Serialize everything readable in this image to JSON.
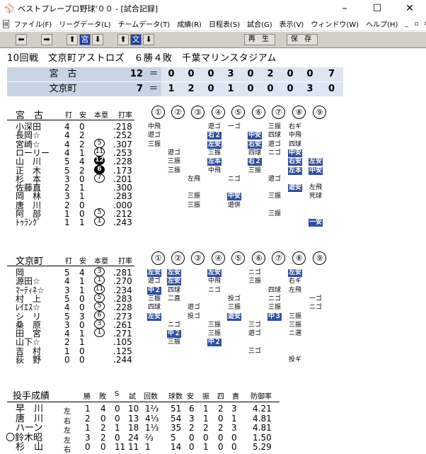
{
  "window": {
    "title": "ベストプレープロ野球'００ - [試合記録]",
    "min": "–",
    "max": "☐",
    "close": "✕"
  },
  "menu": [
    "ファイル(F)",
    "リーグデータ(L)",
    "チームデータ(T)",
    "成績(R)",
    "日程表(S)",
    "試合(G)",
    "表示(V)",
    "ウィンドウ(W)",
    "ヘルプ(H)"
  ],
  "mdi": [
    "_",
    "▫",
    "×"
  ],
  "toolbar": {
    "left": "⬅",
    "right": "➡",
    "team1": "宮",
    "down": "⬇",
    "up": "⬆",
    "team2": "文",
    "replay": "再 生",
    "save": "保 存"
  },
  "game": {
    "info": "10回戦　文京町アストロズ　６勝４敗　千葉マリンスタジアム"
  },
  "score": {
    "away": {
      "name": "宮　古",
      "total": "12",
      "eq": "＝",
      "innings": [
        "0",
        "0",
        "0",
        "3",
        "0",
        "2",
        "0",
        "0",
        "7"
      ]
    },
    "home": {
      "name": "文京町",
      "total": "7",
      "eq": "＝",
      "innings": [
        "1",
        "2",
        "0",
        "1",
        "0",
        "0",
        "0",
        "3",
        "0"
      ]
    }
  },
  "away_batting": {
    "team": "宮　古",
    "headers": [
      "打",
      "安",
      "本塁",
      "打率"
    ],
    "innings": [
      "①",
      "②",
      "③",
      "④",
      "⑤",
      "⑥",
      "⑦",
      "⑧",
      "⑨"
    ],
    "players": [
      {
        "name": "小深田",
        "ab": "4",
        "h": "0",
        "hr": "",
        "avg": ".218"
      },
      {
        "name": "長岡☆",
        "ab": "4",
        "h": "2",
        "hr": "",
        "avg": ".252"
      },
      {
        "name": "宮崎☆",
        "ab": "4",
        "h": "2",
        "hr": "5",
        "avg": ".307"
      },
      {
        "name": "ローリー",
        "ab": "4",
        "h": "1",
        "hr": "11",
        "avg": ".253"
      },
      {
        "name": "山　川",
        "ab": "5",
        "h": "4",
        "hr": "12",
        "avg": ".228"
      },
      {
        "name": "正　木",
        "ab": "5",
        "h": "2",
        "hr": "6",
        "avg": ".173"
      },
      {
        "name": "杉　本",
        "ab": "3",
        "h": "0",
        "hr": "7",
        "avg": ".201"
      },
      {
        "name": "佐藤直",
        "ab": "2",
        "h": "1",
        "hr": "",
        "avg": ".300"
      },
      {
        "name": "岡　林",
        "ab": "3",
        "h": "1",
        "hr": "",
        "avg": ".283"
      },
      {
        "name": "唐　川",
        "ab": "2",
        "h": "0",
        "hr": "",
        "avg": ".000"
      },
      {
        "name": "阿　部",
        "ab": "1",
        "h": "0",
        "hr": "5",
        "avg": ".212"
      },
      {
        "name": "ﾄｩﾗﾝｸﾞ",
        "ab": "1",
        "h": "1",
        "hr": "1",
        "avg": ".243"
      }
    ]
  },
  "home_batting": {
    "team": "文京町",
    "headers": [
      "打",
      "安",
      "本塁",
      "打率"
    ],
    "innings": [
      "①",
      "②",
      "③",
      "④",
      "⑤",
      "⑥",
      "⑦",
      "⑧",
      "⑨"
    ],
    "players": [
      {
        "name": "岡",
        "ab": "5",
        "h": "4",
        "hr": "3",
        "avg": ".281"
      },
      {
        "name": "源田☆",
        "ab": "4",
        "h": "1",
        "hr": "1",
        "avg": ".270"
      },
      {
        "name": "ﾏｰﾃｨﾈ☆",
        "ab": "3",
        "h": "1",
        "hr": "11",
        "avg": ".234"
      },
      {
        "name": "村　上",
        "ab": "5",
        "h": "0",
        "hr": "5",
        "avg": ".283"
      },
      {
        "name": "ﾚｲｴｽ☆",
        "ab": "4",
        "h": "0",
        "hr": "5",
        "avg": ".228"
      },
      {
        "name": "シ　リ",
        "ab": "5",
        "h": "3",
        "hr": "6",
        "avg": ".273"
      },
      {
        "name": "桑　原",
        "ab": "3",
        "h": "0",
        "hr": "3",
        "avg": ".261"
      },
      {
        "name": "田　宮",
        "ab": "4",
        "h": "1",
        "hr": "1",
        "avg": ".271"
      },
      {
        "name": "山下☆",
        "ab": "2",
        "h": "1",
        "hr": "",
        "avg": ".105"
      },
      {
        "name": "吉　村",
        "ab": "1",
        "h": "0",
        "hr": "",
        "avg": ".125"
      },
      {
        "name": "荻　野",
        "ab": "0",
        "h": "0",
        "hr": "",
        "avg": ".244"
      }
    ]
  },
  "pitching": {
    "title": "投手成績",
    "headers": [
      "勝",
      "敗",
      "S",
      "試",
      "回数",
      "球数",
      "安",
      "振",
      "四",
      "責",
      "防御率"
    ],
    "rows": [
      {
        "name": "早　川",
        "hand": "左",
        "w": "1",
        "l": "4",
        "s": "0",
        "g": "10",
        "ip": "1⅔",
        "np": "51",
        "h": "6",
        "k": "1",
        "bb": "2",
        "er": "3",
        "era": "4.21"
      },
      {
        "name": "唐　川",
        "hand": "右",
        "w": "2",
        "l": "0",
        "s": "0",
        "g": "13",
        "ip": "4⅓",
        "np": "54",
        "h": "3",
        "k": "1",
        "bb": "0",
        "er": "1",
        "era": "4.81"
      },
      {
        "name": "ハーン",
        "hand": "左",
        "w": "1",
        "l": "2",
        "s": "1",
        "g": "18",
        "ip": "1⅓",
        "np": "35",
        "h": "2",
        "k": "2",
        "bb": "2",
        "er": "3",
        "era": "4.81"
      },
      {
        "name": "〇鈴木昭",
        "hand": "左",
        "w": "3",
        "l": "2",
        "s": "0",
        "g": "24",
        "ip": "⅔",
        "np": "5",
        "h": "0",
        "k": "0",
        "bb": "0",
        "er": "0",
        "era": "1.50"
      },
      {
        "name": "杉　山",
        "hand": "右",
        "w": "0",
        "l": "0",
        "s": "11",
        "g": "11",
        "ip": "1",
        "np": "14",
        "h": "0",
        "k": "1",
        "bb": "0",
        "er": "0",
        "era": "5.29"
      }
    ]
  },
  "away_results": [
    [
      "中飛",
      "",
      "",
      "遊ゴ",
      "一ゴ",
      "",
      "三振",
      "右ギ",
      ""
    ],
    [
      "遊ゴ",
      "",
      "",
      "右２",
      "",
      "中安",
      "四球",
      "中飛",
      ""
    ],
    [
      "三振",
      "",
      "",
      "左安",
      "",
      "右安",
      "遊ゴ",
      "四球",
      ""
    ],
    [
      "",
      "遊ゴ",
      "",
      "三振",
      "",
      "四球",
      "ニゴ",
      "中安",
      ""
    ],
    [
      "",
      "三振",
      "",
      "左本",
      "",
      "右２",
      "",
      "右安",
      "左安"
    ],
    [
      "",
      "三振",
      "",
      "中飛",
      "",
      "三振",
      "",
      "左本",
      "中安"
    ],
    [
      "",
      "",
      "左飛",
      "",
      "ニゴ",
      "",
      "遊ゴ",
      "",
      ""
    ],
    [
      "",
      "",
      "",
      "",
      "",
      "",
      "",
      "遊安",
      "左飛"
    ],
    [
      "",
      "",
      "三振",
      "",
      "中安",
      "",
      "三振",
      "",
      "死球"
    ],
    [
      "",
      "",
      "三振",
      "",
      "遊併",
      "",
      "",
      "",
      ""
    ],
    [
      "",
      "",
      "",
      "",
      "",
      "",
      "三振",
      "",
      ""
    ],
    [
      "",
      "",
      "",
      "",
      "",
      "",
      "",
      "",
      "一安"
    ]
  ],
  "home_results": [
    [
      "左安",
      "左安",
      "",
      "左安",
      "",
      "ニゴ",
      "",
      "左安",
      ""
    ],
    [
      "遊ゴ",
      "左安",
      "",
      "中飛",
      "",
      "三振",
      "",
      "右ギ",
      ""
    ],
    [
      "中２",
      "四球",
      "",
      "ニゴ",
      "",
      "",
      "四球",
      "左飛",
      ""
    ],
    [
      "三振",
      "二直",
      "",
      "",
      "投ゴ",
      "",
      "ニゴ",
      "",
      "一ゴ"
    ],
    [
      "四球",
      "",
      "遊ゴ",
      "",
      "三振",
      "",
      "三振",
      "",
      "ニゴ"
    ],
    [
      "左安",
      "",
      "投ゴ",
      "",
      "遊安",
      "",
      "中３",
      "三振",
      ""
    ],
    [
      "",
      "ニゴ",
      "",
      "三振",
      "",
      "三ゴ",
      "",
      "三振",
      ""
    ],
    [
      "",
      "中２",
      "",
      "三振",
      "",
      "遊ゴ",
      "",
      "ニ選",
      ""
    ],
    [
      "",
      "三振",
      "",
      "中２",
      "",
      "",
      "",
      "",
      ""
    ],
    [
      "",
      "",
      "",
      "",
      "",
      "三ゴ",
      "",
      "",
      ""
    ],
    [
      "",
      "",
      "",
      "",
      "",
      "",
      "",
      "投ギ",
      ""
    ]
  ],
  "hits_marker": [
    "安",
    "２",
    "３",
    "本"
  ]
}
